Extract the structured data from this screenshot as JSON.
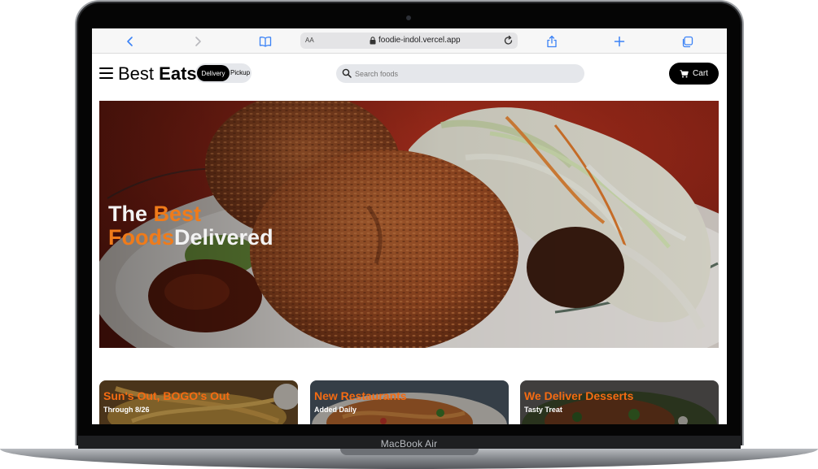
{
  "browser": {
    "text_size_label": "AA",
    "url": "foodie-indol.vercel.app",
    "icons": [
      "back-icon",
      "forward-icon",
      "bookmarks-icon",
      "lock-icon",
      "reload-icon",
      "share-icon",
      "new-tab-icon",
      "tabs-icon"
    ]
  },
  "header": {
    "brand_light": "Best",
    "brand_bold": "Eats",
    "toggle_active": "Delivery",
    "toggle_inactive": "Pickup",
    "search_placeholder": "Search foods",
    "cart_label": "Cart"
  },
  "hero": {
    "line1_white": "The",
    "line1_accent": "Best",
    "line2_accent": "Foods",
    "line2_white": "Delivered"
  },
  "cards": [
    {
      "title": "Sun's Out, BOGO's Out",
      "subtitle": "Through 8/26"
    },
    {
      "title": "New Restaurants",
      "subtitle": "Added Daily"
    },
    {
      "title": "We Deliver Desserts",
      "subtitle": "Tasty Treat"
    }
  ],
  "device": {
    "label": "MacBook Air"
  },
  "colors": {
    "accent": "#f07b1a",
    "card_title": "#f56b12",
    "button_bg": "#000000"
  }
}
